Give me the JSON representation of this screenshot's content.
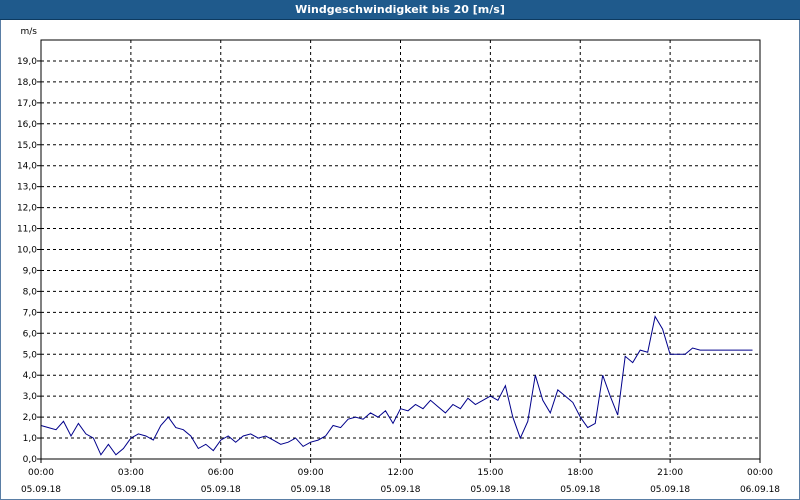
{
  "title": "Windgeschwindigkeit bis 20 [m/s]",
  "colors": {
    "titlebar": "#1f5a8c",
    "line": "#00008b",
    "grid": "#000000"
  },
  "chart_data": {
    "type": "line",
    "title": "Windgeschwindigkeit bis 20 [m/s]",
    "ylabel": "m/s",
    "xlabel": "",
    "ylim": [
      0,
      20
    ],
    "grid": true,
    "y_ticks": [
      "0,0",
      "1,0",
      "2,0",
      "3,0",
      "4,0",
      "5,0",
      "6,0",
      "7,0",
      "8,0",
      "9,0",
      "10,0",
      "11,0",
      "12,0",
      "13,0",
      "14,0",
      "15,0",
      "16,0",
      "17,0",
      "18,0",
      "19,0"
    ],
    "x_ticks": [
      {
        "time": "00:00",
        "date": "05.09.18"
      },
      {
        "time": "03:00",
        "date": "05.09.18"
      },
      {
        "time": "06:00",
        "date": "05.09.18"
      },
      {
        "time": "09:00",
        "date": "05.09.18"
      },
      {
        "time": "12:00",
        "date": "05.09.18"
      },
      {
        "time": "15:00",
        "date": "05.09.18"
      },
      {
        "time": "18:00",
        "date": "05.09.18"
      },
      {
        "time": "21:00",
        "date": "05.09.18"
      },
      {
        "time": "00:00",
        "date": "06.09.18"
      }
    ],
    "series": [
      {
        "x_hours": [
          0,
          0.25,
          0.5,
          0.75,
          1,
          1.25,
          1.5,
          1.75,
          2,
          2.25,
          2.5,
          2.75,
          3,
          3.25,
          3.5,
          3.75,
          4,
          4.25,
          4.5,
          4.75,
          5,
          5.25,
          5.5,
          5.75,
          6,
          6.25,
          6.5,
          6.75,
          7,
          7.25,
          7.5,
          7.75,
          8,
          8.25,
          8.5,
          8.75,
          9,
          9.25,
          9.5,
          9.75,
          10,
          10.25,
          10.5,
          10.75,
          11,
          11.25,
          11.5,
          11.75,
          12,
          12.25,
          12.5,
          12.75,
          13,
          13.25,
          13.5,
          13.75,
          14,
          14.25,
          14.5,
          14.75,
          15,
          15.25,
          15.5,
          15.75,
          16,
          16.25,
          16.5,
          16.75,
          17,
          17.25,
          17.5,
          17.75,
          18,
          18.25,
          18.5,
          18.75,
          19,
          19.25,
          19.5,
          19.75,
          20,
          20.25,
          20.5,
          20.75,
          21,
          21.25,
          21.5,
          21.75,
          22,
          22.25,
          22.5,
          22.75,
          23,
          23.25,
          23.5,
          23.75
        ],
        "values": [
          1.6,
          1.5,
          1.4,
          1.8,
          1.1,
          1.7,
          1.2,
          1.0,
          0.2,
          0.7,
          0.2,
          0.5,
          1.0,
          1.2,
          1.1,
          0.9,
          1.6,
          2.0,
          1.5,
          1.4,
          1.1,
          0.5,
          0.7,
          0.4,
          0.9,
          1.1,
          0.8,
          1.1,
          1.2,
          1.0,
          1.1,
          0.9,
          0.7,
          0.8,
          1.0,
          0.6,
          0.8,
          0.9,
          1.1,
          1.6,
          1.5,
          1.9,
          2.0,
          1.9,
          2.2,
          2.0,
          2.3,
          1.7,
          2.4,
          2.3,
          2.6,
          2.4,
          2.8,
          2.5,
          2.2,
          2.6,
          2.4,
          2.9,
          2.6,
          2.8,
          3.0,
          2.8,
          3.5,
          2.0,
          1.0,
          1.8,
          4.0,
          2.8,
          2.2,
          3.3,
          3.0,
          2.7,
          2.0,
          1.5,
          1.7,
          4.0,
          3.0,
          2.1,
          4.9,
          4.6,
          5.2,
          5.1,
          6.8,
          6.2,
          5.0,
          5.0,
          5.0,
          5.3,
          5.2,
          5.2,
          5.2,
          5.2,
          5.2,
          5.2,
          5.2,
          5.2
        ]
      }
    ]
  }
}
